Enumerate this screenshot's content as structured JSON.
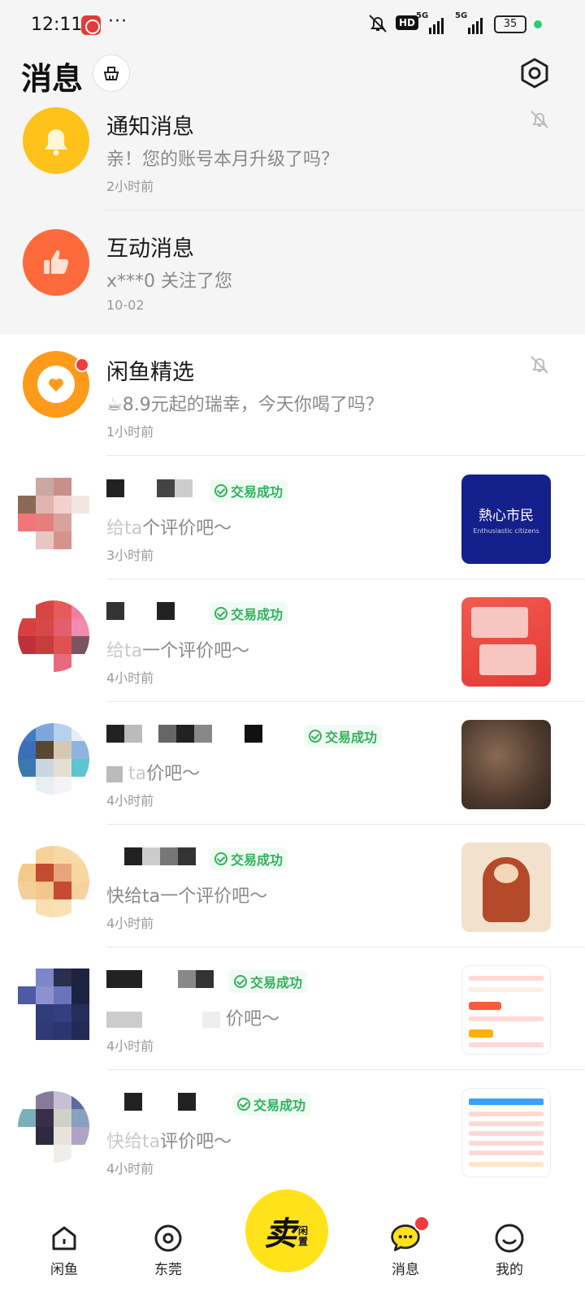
{
  "status_bar": {
    "time": "12:11",
    "dots": "···",
    "hd_label": "HD",
    "signal_1": "5G",
    "signal_2": "5G",
    "battery": "35"
  },
  "header": {
    "title": "消息"
  },
  "conversations": [
    {
      "title": "通知消息",
      "subtitle": "亲！您的账号本月升级了吗？",
      "time": "2小时前",
      "icon": "bell-icon",
      "color": "#ffc21a"
    },
    {
      "title": "互动消息",
      "subtitle": "x***0 关注了您",
      "time": "10-02",
      "icon": "thumbs-up-icon",
      "color": "#ff6a3d"
    },
    {
      "title": "闲鱼精选",
      "subtitle": "☕8.9元起的瑞幸，今天你喝了吗？",
      "time": "1小时前",
      "icon": "heart-icon",
      "color": "#ff9a1a"
    }
  ],
  "trades": [
    {
      "badge": "交易成功",
      "subtitle": "个评价吧～",
      "subtitle_prefix": "给ta",
      "time": "3小时前",
      "thumb_text": "熱心市民",
      "thumb_small": "Enthusiastic citizens"
    },
    {
      "badge": "交易成功",
      "subtitle": "一个评价吧～",
      "subtitle_prefix": "给ta",
      "time": "4小时前"
    },
    {
      "badge": "交易成功",
      "subtitle": "价吧～",
      "subtitle_prefix": "ta",
      "time": "4小时前"
    },
    {
      "badge": "交易成功",
      "subtitle": "快给ta一个评价吧～",
      "time": "4小时前"
    },
    {
      "badge": "交易成功",
      "subtitle": "价吧～",
      "time": "4小时前"
    },
    {
      "badge": "交易成功",
      "subtitle": "评价吧～",
      "subtitle_prefix": "快给ta",
      "time": "4小时前"
    }
  ],
  "tabbar": {
    "tabs": [
      {
        "label": "闲鱼",
        "icon": "home-icon"
      },
      {
        "label": "东莞",
        "icon": "location-icon"
      },
      {
        "label": "消息",
        "icon": "message-icon"
      },
      {
        "label": "我的",
        "icon": "profile-icon"
      }
    ],
    "sell_big": "卖",
    "sell_small": "闲置",
    "accent": "#ffe21a"
  }
}
